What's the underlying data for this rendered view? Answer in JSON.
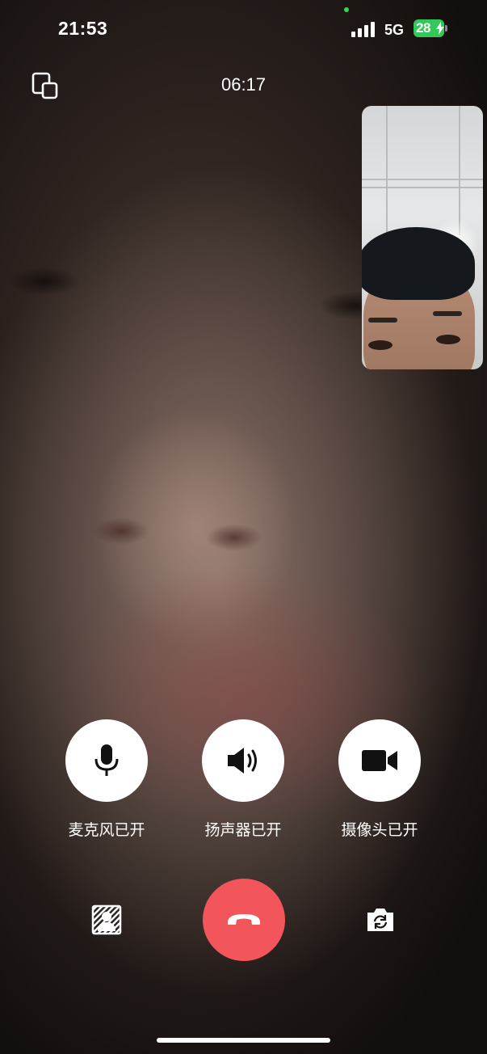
{
  "status_bar": {
    "time": "21:53",
    "network": "5G",
    "battery_level": "28",
    "battery_color": "#34c759",
    "privacy_dot_color": "#32d74b"
  },
  "call": {
    "duration": "06:17",
    "minimize_icon": "picture-in-picture-icon"
  },
  "controls": [
    {
      "id": "microphone",
      "icon": "microphone-icon",
      "label": "麦克风已开"
    },
    {
      "id": "speaker",
      "icon": "speaker-icon",
      "label": "扬声器已开"
    },
    {
      "id": "camera",
      "icon": "video-camera-icon",
      "label": "摄像头已开"
    }
  ],
  "bottom": {
    "background_blur_icon": "background-blur-icon",
    "hangup_icon": "phone-hangup-icon",
    "hangup_color": "#f2555a",
    "flip_camera_icon": "flip-camera-icon"
  }
}
